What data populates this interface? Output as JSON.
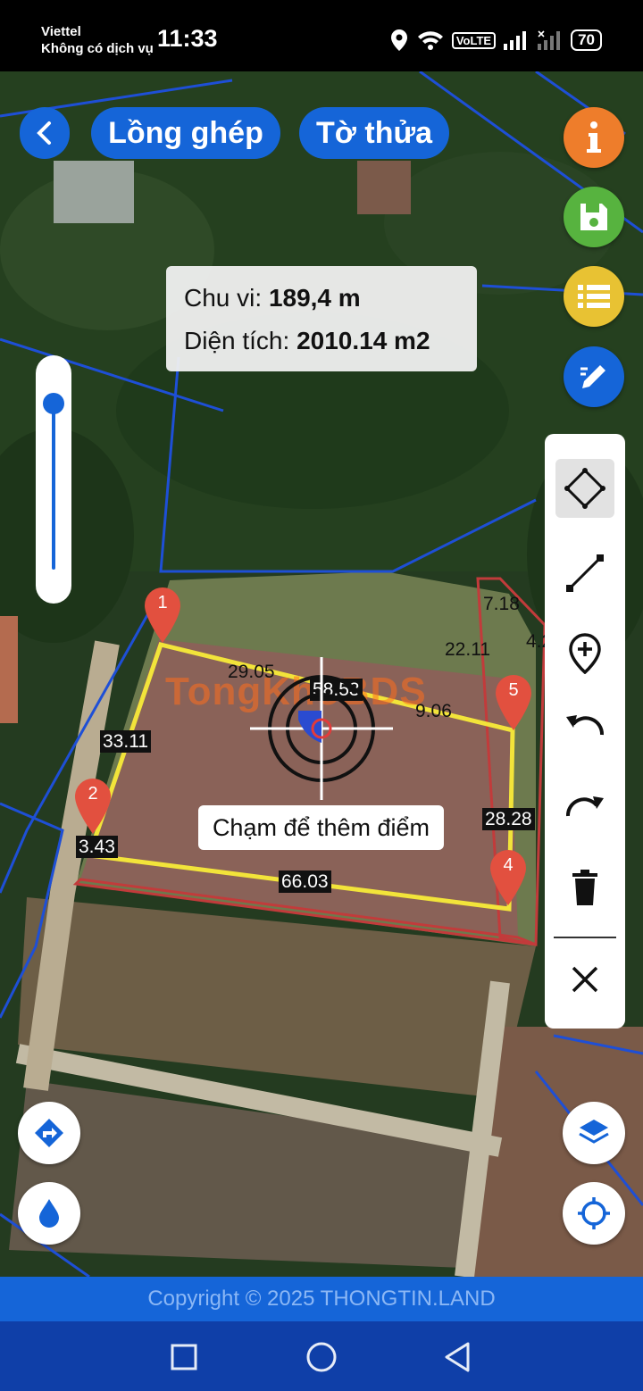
{
  "status_bar": {
    "carrier": "Viettel",
    "service": "Không có dịch vụ",
    "time": "11:33",
    "network_badge": "VoLTE",
    "battery": "70"
  },
  "header": {
    "back_icon": "chevron-left-icon",
    "btn_overlay": "Lồng ghép",
    "btn_sheet": "Tờ thửa"
  },
  "right_actions": [
    {
      "icon": "info-icon",
      "color": "#ee7d2b"
    },
    {
      "icon": "save-icon",
      "color": "#57b33f"
    },
    {
      "icon": "list-icon",
      "color": "#e8c233"
    },
    {
      "icon": "edit-tool-icon",
      "color": "#1565d8"
    }
  ],
  "measurement": {
    "perimeter_label": "Chu vi:",
    "perimeter_value": "189,4 m",
    "area_label": "Diện tích:",
    "area_value": "2010.14 m2"
  },
  "zoom_level": 0.95,
  "toolbar_tools": [
    {
      "icon": "polygon-icon",
      "selected": true
    },
    {
      "icon": "line-icon",
      "selected": false
    },
    {
      "icon": "add-point-icon",
      "selected": false
    },
    {
      "icon": "undo-icon",
      "selected": false
    },
    {
      "icon": "redo-icon",
      "selected": false
    },
    {
      "icon": "delete-icon",
      "selected": false
    },
    {
      "icon": "close-icon",
      "selected": false
    }
  ],
  "markers": [
    "1",
    "2",
    "4",
    "5"
  ],
  "edge_labels": {
    "e1": "29.05",
    "e2": "58.53",
    "e3": "9.06",
    "e4": "33.11",
    "e5": "3.43",
    "e6": "28.28",
    "e7": "66.03",
    "e8": "7.18",
    "e9": "22.11",
    "e10": "4.2"
  },
  "hint": "Chạm để thêm điểm",
  "watermark": "TongKhoBDS",
  "copyright": "Copyright © 2025 THONGTIN.LAND",
  "colors": {
    "accent_blue": "#1565d8",
    "polygon_yellow": "#f2e43a",
    "parcel_red": "#c23b3b",
    "marker_red": "#e2503f"
  }
}
